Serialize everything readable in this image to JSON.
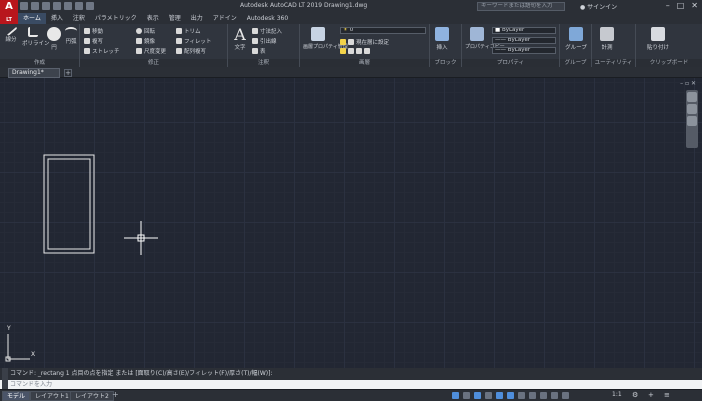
{
  "app": {
    "title": "Autodesk AutoCAD LT 2019   Drawing1.dwg",
    "logo_letter": "A",
    "logo_sublabel": "LT"
  },
  "search": {
    "placeholder": "キーワードまたは語句を入力"
  },
  "account": {
    "signin": "サインイン"
  },
  "window_controls": {
    "minimize": "–",
    "maximize": "□",
    "close": "✕"
  },
  "ribbon_tabs": [
    "ホーム",
    "挿入",
    "注釈",
    "パラメトリック",
    "表示",
    "管理",
    "出力",
    "アドイン",
    "Autodesk 360"
  ],
  "ribbon": {
    "panels": {
      "draw": "作成",
      "modify": "修正",
      "annotation": "注釈",
      "layers": "画層",
      "block": "ブロック",
      "properties": "プロパティ",
      "groups": "グループ",
      "utilities": "ユーティリティ",
      "clipboard": "クリップボード"
    },
    "draw_tools": {
      "line": "線分",
      "polyline": "ポリライン",
      "circle": "円",
      "arc": "円弧"
    },
    "modify_tools": {
      "move": "移動",
      "rotate": "回転",
      "trim": "トリム",
      "copy": "複写",
      "mirror": "鏡像",
      "fillet": "フィレット",
      "stretch": "ストレッチ",
      "scale": "尺度変更",
      "array": "配列複写"
    },
    "annotation_tools": {
      "text": "文字",
      "dimension": "寸法記入",
      "leader": "引出線",
      "table": "表"
    },
    "layer_tools": {
      "layer_props": "画層プロパティ管理",
      "layer_current": "現在層に設定",
      "layer_name": "0"
    },
    "block_tools": {
      "insert": "挿入"
    },
    "property_tools": {
      "match": "プロパティコピー",
      "color": "ByLayer",
      "linetype": "ByLayer",
      "lineweight": "ByLayer"
    },
    "group_tools": {
      "group": "グループ"
    },
    "utility_tools": {
      "measure": "計測"
    },
    "clipboard_tools": {
      "paste": "貼り付け"
    }
  },
  "file_tabs": {
    "active": "Drawing1*",
    "new": "+"
  },
  "viewport": {
    "controls": "–  ▫  ✕"
  },
  "command_line": {
    "history": "コマンド: _rectang  1 点目の点を指定 または [面取り(C)/高さ(E)/フィレット(F)/厚さ(T)/幅(W)]:",
    "prompt": "コマンドを入力"
  },
  "layout_tabs": [
    "モデル",
    "レイアウト1",
    "レイアウト2"
  ],
  "status": {
    "scale": "1:1"
  },
  "ucs": {
    "x_label": "X",
    "y_label": "Y"
  }
}
